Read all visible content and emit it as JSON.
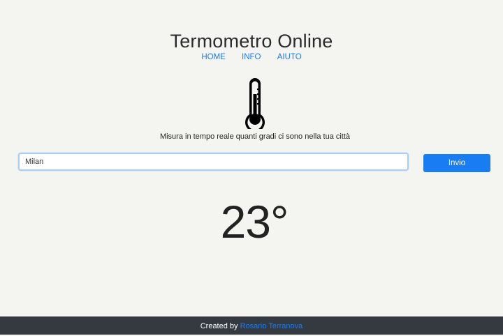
{
  "header": {
    "title": "Termometro Online"
  },
  "nav": {
    "items": [
      {
        "label": "HOME"
      },
      {
        "label": "INFO"
      },
      {
        "label": "AIUTO"
      }
    ]
  },
  "hero": {
    "icon": "thermometer-icon",
    "tagline": "Misura in tempo reale quanti gradi ci sono nella tua città"
  },
  "search": {
    "value": "Milan",
    "button_label": "Invio"
  },
  "result": {
    "temperature": "23°"
  },
  "footer": {
    "prefix": "Created by",
    "author": "Rosario Terranova"
  },
  "colors": {
    "accent": "#1a7cf2",
    "background": "#f4f4f1",
    "footer": "#343a40"
  }
}
